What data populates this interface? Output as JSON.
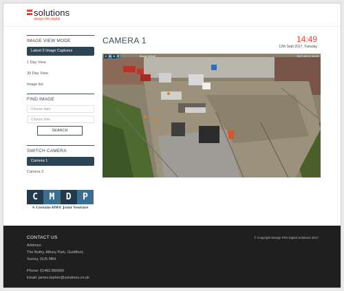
{
  "header": {
    "logo_text": "solutions",
    "logo_sub": "design film digital",
    "accent": "#e0462f"
  },
  "sidebar": {
    "view_mode_title": "IMAGE VIEW MODE",
    "view_modes": [
      "Latest 3 Image Captures",
      "1 Day View",
      "30 Day View",
      "Image list"
    ],
    "find_title": "FIND IMAGE",
    "date_placeholder": "Choose date",
    "time_placeholder": "Choose time",
    "search_label": "SEARCH",
    "switch_title": "SWITCH CAMERA",
    "cameras": [
      "Camera 1",
      "Camera 2"
    ]
  },
  "cmdp": {
    "letters": [
      "C",
      "M",
      "D",
      "P"
    ],
    "colors": [
      "#223a4a",
      "#3a6f92",
      "#223a4a",
      "#3a6f92"
    ],
    "tagline": "A Costain-HWE Joint Venture"
  },
  "main": {
    "title": "CAMERA 1",
    "time": "14:49",
    "date": "12th Sept 2017, Tuesday"
  },
  "camera_hud": {
    "brand": [
      "C",
      "M",
      "D",
      "P"
    ],
    "name": "Brede WWW",
    "timestamp": "2017-09-12 14:49"
  },
  "footer": {
    "title": "CONTACT US",
    "address_label": "Address:",
    "address_1": "The Bothy, Albury Park, Guildford,",
    "address_2": "Surrey, GU5 9BH",
    "phone": "Phone: 01483 866066",
    "email": "Email: james.barber@solutions.co.uk",
    "copyright": "© Copyright Design Film Digital Solutions 2017"
  }
}
